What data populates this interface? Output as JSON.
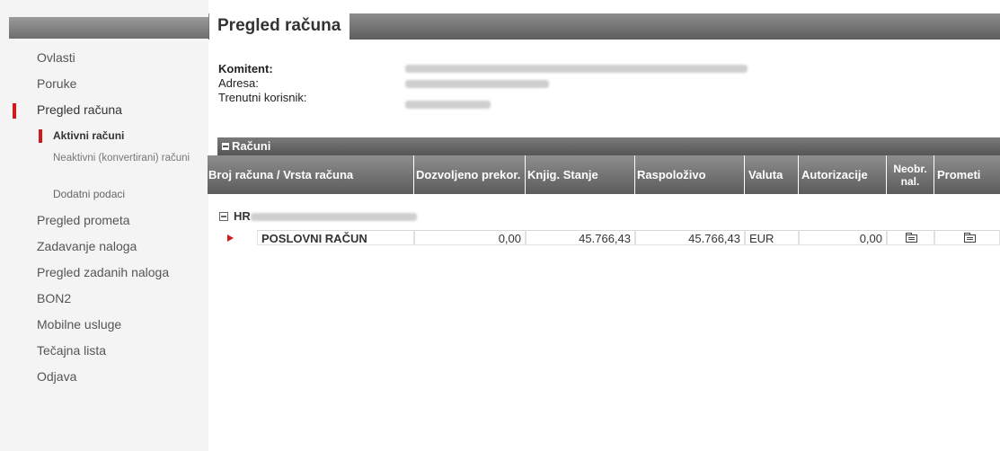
{
  "page": {
    "title": "Pregled računa"
  },
  "sidebar": {
    "items": [
      {
        "label": "Ovlasti"
      },
      {
        "label": "Poruke"
      },
      {
        "label": "Pregled računa"
      },
      {
        "label": "Aktivni računi"
      },
      {
        "label": "Neaktivni (konvertirani) računi"
      },
      {
        "label": "Dodatni podaci"
      },
      {
        "label": "Pregled prometa"
      },
      {
        "label": "Zadavanje naloga"
      },
      {
        "label": "Pregled zadanih naloga"
      },
      {
        "label": "BON2"
      },
      {
        "label": "Mobilne usluge"
      },
      {
        "label": "Tečajna lista"
      },
      {
        "label": "Odjava"
      }
    ]
  },
  "info": {
    "komitent_label": "Komitent:",
    "adresa_label": "Adresa:",
    "korisnik_label": "Trenutni korisnik:"
  },
  "accounts": {
    "section_title": "Računi",
    "columns": [
      "Broj računa / Vrsta računa",
      "Dozvoljeno prekor.",
      "Knjig. Stanje",
      "Raspoloživo",
      "Valuta",
      "Autorizacije",
      "Neobr. nal.",
      "Prometi"
    ],
    "group_prefix": "HR",
    "rows": [
      {
        "type": "POSLOVNI RAČUN",
        "dozvoljeno": "0,00",
        "knjig_stanje": "45.766,43",
        "raspolozivo": "45.766,43",
        "valuta": "EUR",
        "autorizacije": "0,00"
      }
    ]
  },
  "colors": {
    "accent": "#d01a1a",
    "header_dark": "#5e5e5e"
  }
}
